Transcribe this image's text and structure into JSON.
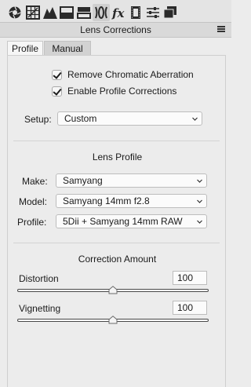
{
  "toolbar": {
    "tools": [
      {
        "icon": "aperture-icon"
      },
      {
        "icon": "grid-icon"
      },
      {
        "icon": "tone-curve-icon"
      },
      {
        "icon": "split-panel-icon"
      },
      {
        "icon": "split-toning-icon"
      },
      {
        "icon": "lens-corrections-icon",
        "active": true
      },
      {
        "icon": "fx-icon"
      },
      {
        "icon": "filmstrip-icon"
      },
      {
        "icon": "sliders-icon"
      },
      {
        "icon": "presets-icon"
      }
    ]
  },
  "panel": {
    "title": "Lens Corrections"
  },
  "tabs": {
    "profile": "Profile",
    "manual": "Manual"
  },
  "checks": {
    "remove_ca": "Remove Chromatic Aberration",
    "enable_profile": "Enable Profile Corrections"
  },
  "setup": {
    "label": "Setup:",
    "value": "Custom"
  },
  "lens_profile": {
    "title": "Lens Profile",
    "make_label": "Make:",
    "make_value": "Samyang",
    "model_label": "Model:",
    "model_value": "Samyang 14mm f2.8",
    "profile_label": "Profile:",
    "profile_value": "5Dii + Samyang 14mm RAW"
  },
  "correction": {
    "title": "Correction Amount",
    "distortion_label": "Distortion",
    "distortion_value": "100",
    "distortion_level": 0.5,
    "vignetting_label": "Vignetting",
    "vignetting_value": "100",
    "vignetting_level": 0.5
  }
}
